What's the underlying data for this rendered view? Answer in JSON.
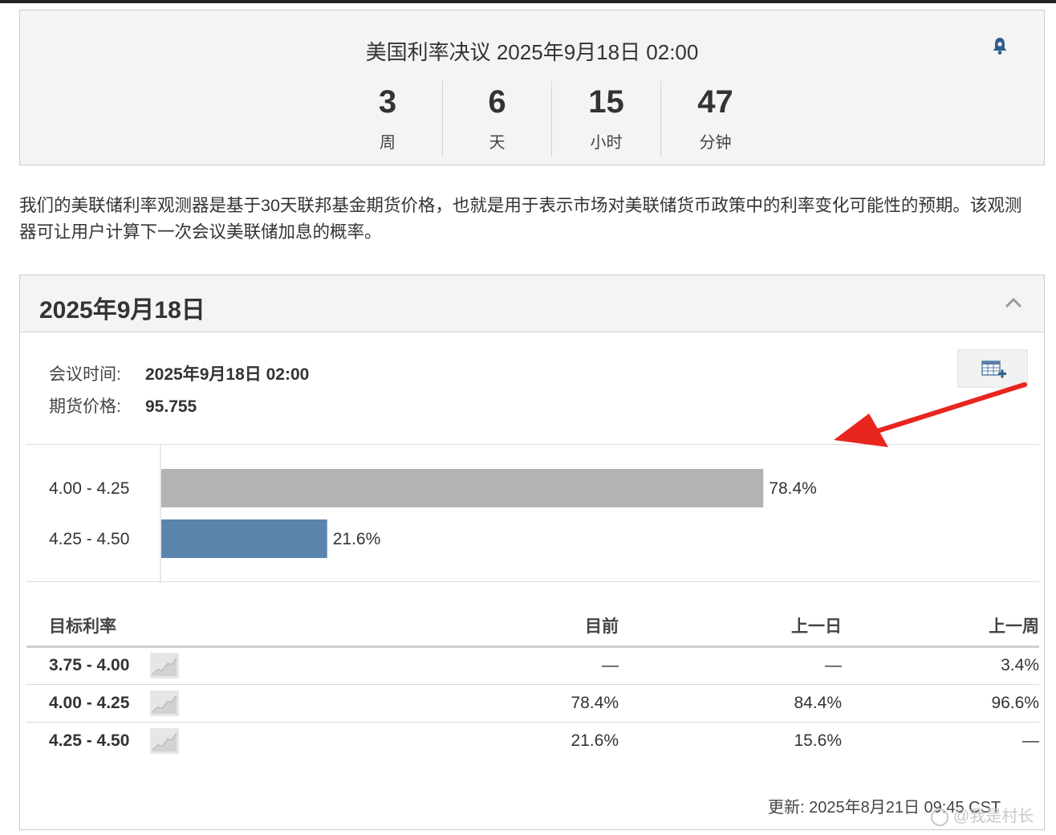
{
  "countdown": {
    "title": "美国利率决议 2025年9月18日 02:00",
    "units": [
      {
        "value": "3",
        "label": "周"
      },
      {
        "value": "6",
        "label": "天"
      },
      {
        "value": "15",
        "label": "小时"
      },
      {
        "value": "47",
        "label": "分钟"
      }
    ],
    "bell_icon": "bell-icon"
  },
  "intro": "我们的美联储利率观测器是基于30天联邦基金期货价格，也就是用于表示市场对美联储货币政策中的利率变化可能性的预期。该观测器可让用户计算下一次会议美联储加息的概率。",
  "meeting": {
    "title": "2025年9月18日",
    "time_label": "会议时间:",
    "time_value": "2025年9月18日 02:00",
    "price_label": "期货价格:",
    "price_value": "95.755",
    "calendar_icon": "calendar-add-icon"
  },
  "chart_data": {
    "type": "bar",
    "orientation": "horizontal",
    "categories": [
      "4.00 - 4.25",
      "4.25 - 4.50"
    ],
    "values": [
      78.4,
      21.6
    ],
    "labels": [
      "78.4%",
      "21.6%"
    ],
    "colors": [
      "#b3b3b3",
      "#5b84ad"
    ],
    "xlim": [
      0,
      100
    ]
  },
  "table": {
    "headers": [
      "目标利率",
      "目前",
      "上一日",
      "上一周"
    ],
    "rows": [
      {
        "range": "3.75 - 4.00",
        "current": "—",
        "prev_day": "—",
        "prev_week": "3.4%"
      },
      {
        "range": "4.00 - 4.25",
        "current": "78.4%",
        "prev_day": "84.4%",
        "prev_week": "96.6%"
      },
      {
        "range": "4.25 - 4.50",
        "current": "21.6%",
        "prev_day": "15.6%",
        "prev_week": "—"
      }
    ]
  },
  "updated": "更新: 2025年8月21日 09:45 CST",
  "watermark": "@我是村长",
  "colors": {
    "annotation_arrow": "#e8261f",
    "bar_current": "#b3b3b3",
    "bar_other": "#5b84ad"
  }
}
